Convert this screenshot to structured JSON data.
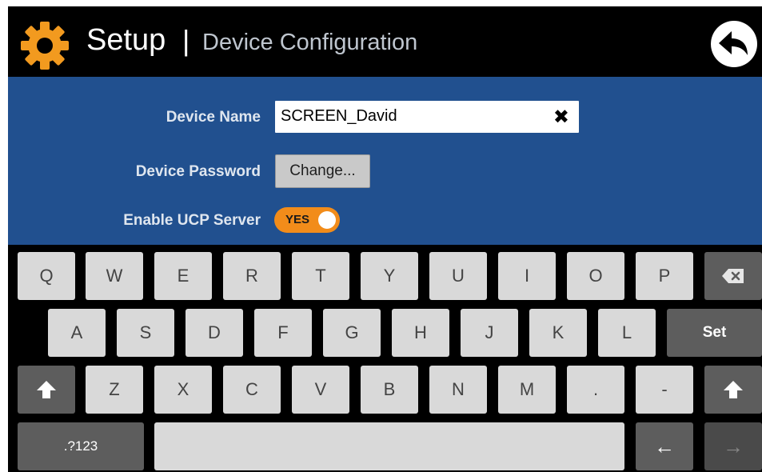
{
  "header": {
    "title": "Setup",
    "separator": "|",
    "subtitle": "Device Configuration",
    "icon": "gear-icon",
    "back_icon": "back-arrow-icon"
  },
  "form": {
    "device_name_label": "Device Name",
    "device_name_value": "SCREEN_David",
    "clear_symbol": "✖",
    "device_password_label": "Device Password",
    "change_button": "Change...",
    "ucp_label": "Enable UCP Server",
    "ucp_toggle_text": "YES",
    "ucp_enabled": true
  },
  "keyboard": {
    "row1": [
      "Q",
      "W",
      "E",
      "R",
      "T",
      "Y",
      "U",
      "I",
      "O",
      "P"
    ],
    "row2": [
      "A",
      "S",
      "D",
      "F",
      "G",
      "H",
      "J",
      "K",
      "L"
    ],
    "row3": [
      "Z",
      "X",
      "C",
      "V",
      "B",
      "N",
      "M",
      ".",
      "-"
    ],
    "set_label": "Set",
    "symbols_label": ".?123",
    "backspace_icon": "backspace-icon",
    "shift_icon": "shift-icon",
    "left_arrow": "←",
    "right_arrow": "→"
  },
  "colors": {
    "accent": "#f28c1a",
    "panel": "#21508f",
    "header": "#000000"
  }
}
